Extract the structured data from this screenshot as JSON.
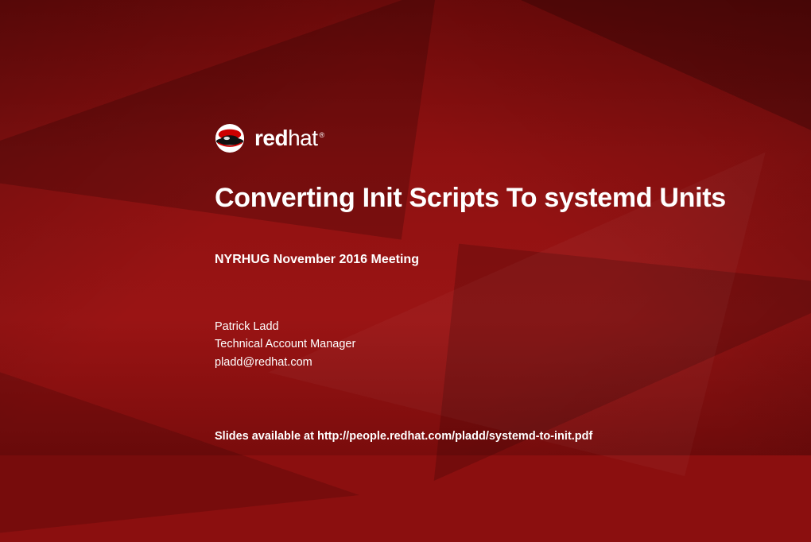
{
  "logo": {
    "word_bold": "red",
    "word_light": "hat",
    "trademark": "®"
  },
  "title": "Converting Init Scripts To systemd Units",
  "subtitle": "NYRHUG November 2016 Meeting",
  "author": {
    "name": "Patrick Ladd",
    "role": "Technical Account Manager",
    "email": "pladd@redhat.com"
  },
  "footer": "Slides available at http://people.redhat.com/pladd/systemd-to-init.pdf"
}
